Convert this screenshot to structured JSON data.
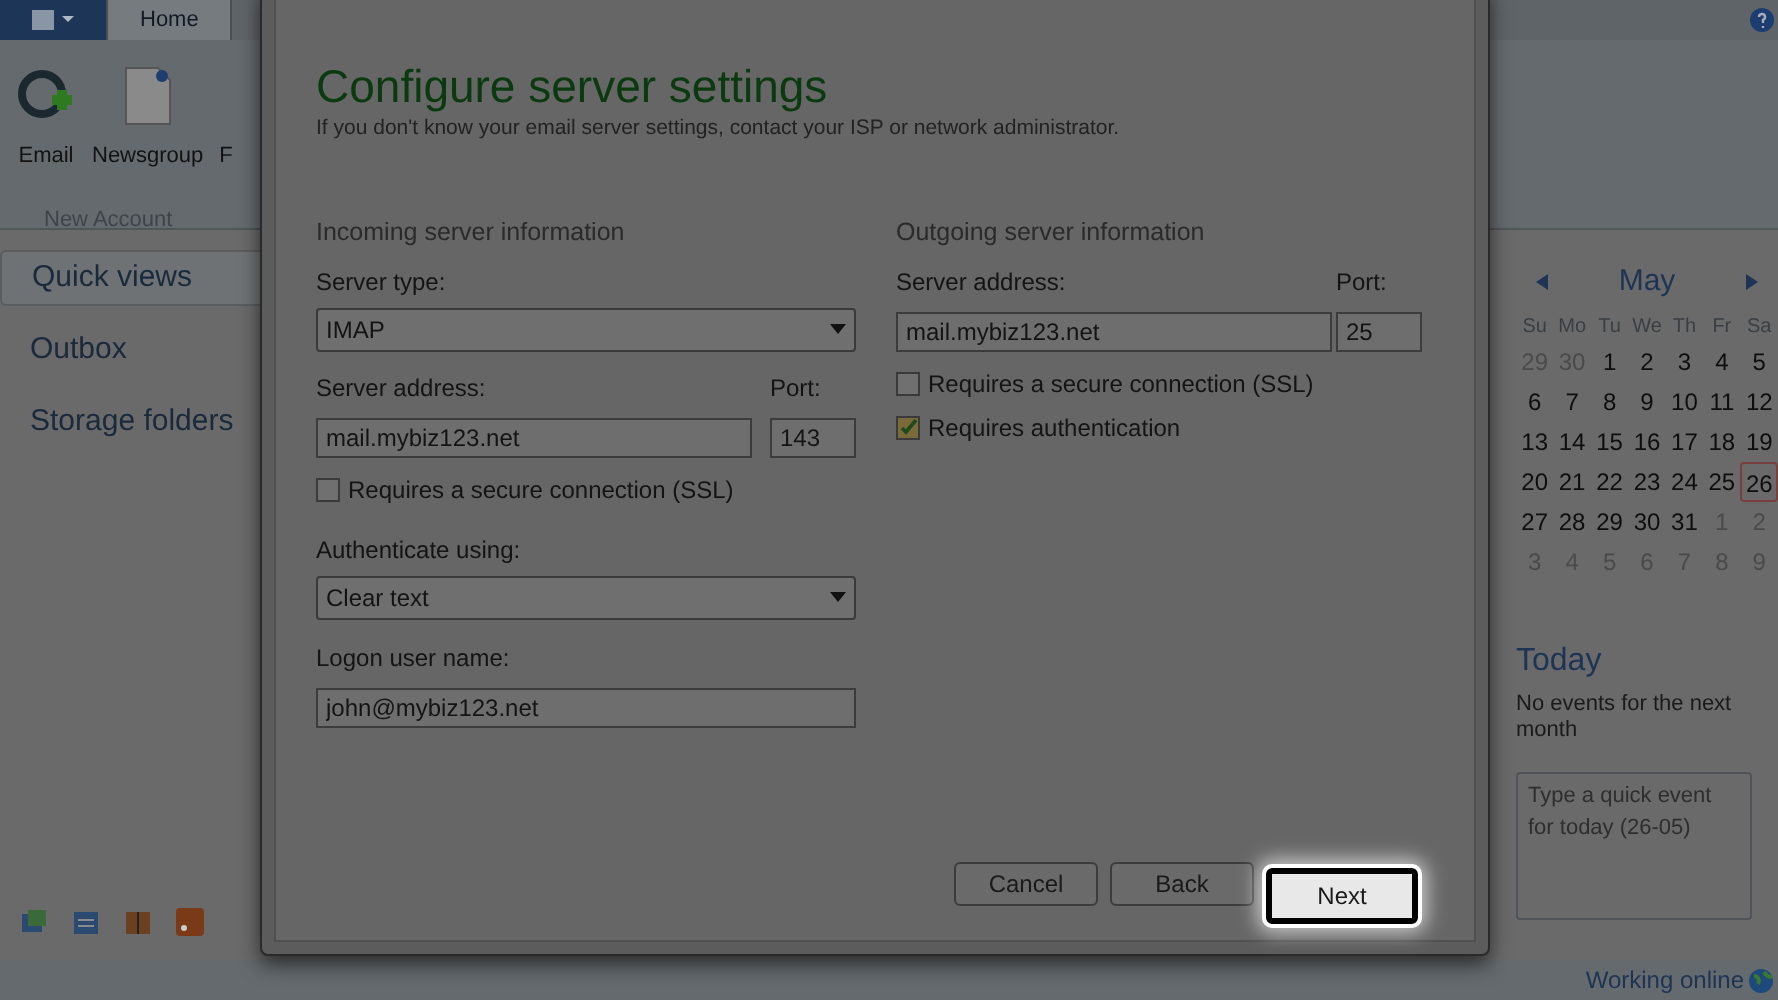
{
  "ribbon": {
    "tabs": [
      {
        "label": "Home",
        "selected": true
      }
    ],
    "items": [
      {
        "label": "Email",
        "kind": "email"
      },
      {
        "label": "Newsgroup",
        "kind": "newsgroup"
      },
      {
        "label": "F",
        "kind": "cut"
      }
    ],
    "group_label": "New Account"
  },
  "sidebar": {
    "items": [
      {
        "label": "Quick views",
        "selected": true
      },
      {
        "label": "Outbox",
        "selected": false
      },
      {
        "label": "Storage folders",
        "selected": false
      }
    ]
  },
  "dialog": {
    "title": "Configure server settings",
    "subtitle": "If you don't know your email server settings, contact your ISP or network administrator.",
    "incoming": {
      "heading": "Incoming server information",
      "server_type_label": "Server type:",
      "server_type": "IMAP",
      "address_label": "Server address:",
      "address": "mail.mybiz123.net",
      "port_label": "Port:",
      "port": "143",
      "ssl_label": "Requires a secure connection (SSL)",
      "ssl_checked": false,
      "auth_label": "Authenticate using:",
      "auth": "Clear text",
      "user_label": "Logon user name:",
      "user": "john@mybiz123.net"
    },
    "outgoing": {
      "heading": "Outgoing server information",
      "address_label": "Server address:",
      "address": "mail.mybiz123.net",
      "port_label": "Port:",
      "port": "25",
      "ssl_label": "Requires a secure connection (SSL)",
      "ssl_checked": false,
      "auth_label": "Requires authentication",
      "auth_checked": true
    },
    "buttons": [
      {
        "label": "Cancel",
        "highlighted": false
      },
      {
        "label": "Back",
        "highlighted": false
      },
      {
        "label": "Next",
        "highlighted": true
      }
    ]
  },
  "calendar": {
    "month": "May",
    "weekdays": [
      "Su",
      "Mo",
      "Tu",
      "We",
      "Th",
      "Fr",
      "Sa"
    ],
    "days": [
      {
        "d": "29",
        "other": true,
        "today": false
      },
      {
        "d": "30",
        "other": true,
        "today": false
      },
      {
        "d": "1",
        "other": false,
        "today": false
      },
      {
        "d": "2",
        "other": false,
        "today": false
      },
      {
        "d": "3",
        "other": false,
        "today": false
      },
      {
        "d": "4",
        "other": false,
        "today": false
      },
      {
        "d": "5",
        "other": false,
        "today": false
      },
      {
        "d": "6",
        "other": false,
        "today": false
      },
      {
        "d": "7",
        "other": false,
        "today": false
      },
      {
        "d": "8",
        "other": false,
        "today": false
      },
      {
        "d": "9",
        "other": false,
        "today": false
      },
      {
        "d": "10",
        "other": false,
        "today": false
      },
      {
        "d": "11",
        "other": false,
        "today": false
      },
      {
        "d": "12",
        "other": false,
        "today": false
      },
      {
        "d": "13",
        "other": false,
        "today": false
      },
      {
        "d": "14",
        "other": false,
        "today": false
      },
      {
        "d": "15",
        "other": false,
        "today": false
      },
      {
        "d": "16",
        "other": false,
        "today": false
      },
      {
        "d": "17",
        "other": false,
        "today": false
      },
      {
        "d": "18",
        "other": false,
        "today": false
      },
      {
        "d": "19",
        "other": false,
        "today": false
      },
      {
        "d": "20",
        "other": false,
        "today": false
      },
      {
        "d": "21",
        "other": false,
        "today": false
      },
      {
        "d": "22",
        "other": false,
        "today": false
      },
      {
        "d": "23",
        "other": false,
        "today": false
      },
      {
        "d": "24",
        "other": false,
        "today": false
      },
      {
        "d": "25",
        "other": false,
        "today": false
      },
      {
        "d": "26",
        "other": false,
        "today": true
      },
      {
        "d": "27",
        "other": false,
        "today": false
      },
      {
        "d": "28",
        "other": false,
        "today": false
      },
      {
        "d": "29",
        "other": false,
        "today": false
      },
      {
        "d": "30",
        "other": false,
        "today": false
      },
      {
        "d": "31",
        "other": false,
        "today": false
      },
      {
        "d": "1",
        "other": true,
        "today": false
      },
      {
        "d": "2",
        "other": true,
        "today": false
      },
      {
        "d": "3",
        "other": true,
        "today": false
      },
      {
        "d": "4",
        "other": true,
        "today": false
      },
      {
        "d": "5",
        "other": true,
        "today": false
      },
      {
        "d": "6",
        "other": true,
        "today": false
      },
      {
        "d": "7",
        "other": true,
        "today": false
      },
      {
        "d": "8",
        "other": true,
        "today": false
      },
      {
        "d": "9",
        "other": true,
        "today": false
      }
    ],
    "today_heading": "Today",
    "no_events": "No events for the next month",
    "quick_event_placeholder": "Type a quick event for today (26-05)"
  },
  "status_bar": {
    "text": "Working online"
  }
}
